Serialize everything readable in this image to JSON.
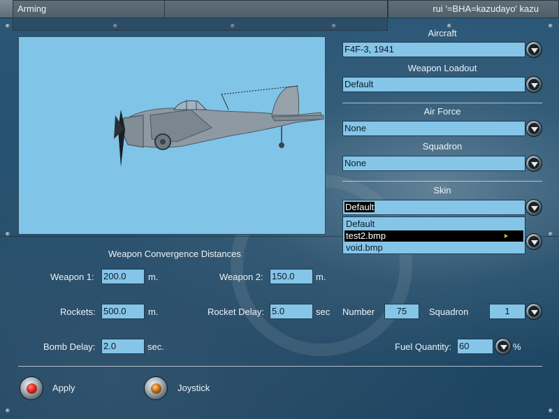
{
  "window": {
    "title": "Arming",
    "user": "rui '=BHA=kazudayo' kazu"
  },
  "aircraft": {
    "label": "Aircraft",
    "value": "F4F-3, 1941"
  },
  "weapon_loadout": {
    "label": "Weapon Loadout",
    "value": "Default"
  },
  "air_force": {
    "label": "Air Force",
    "value": "None"
  },
  "squadron_select": {
    "label": "Squadron",
    "value": "None"
  },
  "skin": {
    "label": "Skin",
    "value": "Default",
    "options": [
      "Default",
      "test2.bmp",
      "void.bmp"
    ],
    "highlighted": "test2.bmp"
  },
  "convergence": {
    "heading": "Weapon Convergence Distances",
    "weapon1_label": "Weapon 1:",
    "weapon1_value": "200.0",
    "weapon1_unit": "m.",
    "weapon2_label": "Weapon 2:",
    "weapon2_value": "150.0",
    "weapon2_unit": "m.",
    "rockets_label": "Rockets:",
    "rockets_value": "500.0",
    "rockets_unit": "m.",
    "rocket_delay_label": "Rocket Delay:",
    "rocket_delay_value": "5.0",
    "rocket_delay_unit": "sec",
    "bomb_delay_label": "Bomb Delay:",
    "bomb_delay_value": "2.0",
    "bomb_delay_unit": "sec."
  },
  "markings": {
    "number_label": "Number",
    "number_value": "75",
    "squadron_label": "Squadron",
    "squadron_value": "1"
  },
  "fuel": {
    "label": "Fuel Quantity:",
    "value": "60",
    "unit": "%"
  },
  "buttons": {
    "apply": "Apply",
    "joystick": "Joystick"
  },
  "colors": {
    "field_bg": "#85c5e8",
    "preview_bg": "#80c4e8",
    "panel_bg": "#22506f"
  }
}
